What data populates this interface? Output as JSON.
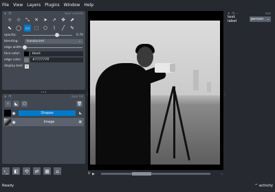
{
  "menu": [
    "File",
    "View",
    "Layers",
    "Plugins",
    "Window",
    "Help"
  ],
  "layer_controls": {
    "dock_title": "layer controls",
    "tools": [
      {
        "icon": "vertex-remove-icon",
        "glyph": "⊹"
      },
      {
        "icon": "vertex-insert-icon",
        "glyph": "⊹"
      },
      {
        "icon": "select-vertices-icon",
        "glyph": "⤡"
      },
      {
        "icon": "delete-shape-icon",
        "glyph": "✕"
      },
      {
        "icon": "select-shape-icon",
        "glyph": "➤"
      },
      {
        "icon": "direct-select-icon",
        "glyph": "➚"
      },
      {
        "icon": "pan-zoom-icon",
        "glyph": "✥"
      },
      {
        "icon": "move-front-icon",
        "glyph": "⬈"
      },
      {
        "icon": "move-back-icon",
        "glyph": "⬉"
      },
      {
        "icon": "ellipse-icon",
        "glyph": "◯"
      },
      {
        "icon": "rectangle-icon",
        "glyph": "▭"
      },
      {
        "icon": "add-rectangle-icon",
        "glyph": "⬚"
      },
      {
        "icon": "polygon-icon",
        "glyph": "⬠"
      },
      {
        "icon": "path-icon",
        "glyph": "⌇"
      },
      {
        "icon": "line-icon",
        "glyph": "╱"
      },
      {
        "icon": "freehand-icon",
        "glyph": "✎"
      }
    ],
    "active_tool_index": 10,
    "opacity_label": "opacity:",
    "opacity_value": "0.70",
    "opacity_fraction": 0.7,
    "blending_label": "blending:",
    "blending_value": "translucent",
    "edge_width_label": "edge width:",
    "edge_width_fraction": 0.0,
    "face_color_label": "face color:",
    "face_color_value": "black",
    "face_color_hex": "#000000",
    "edge_color_label": "edge color:",
    "edge_color_value": "#777777ff",
    "edge_color_hex": "#777777",
    "display_text_label": "display text:",
    "display_text_checked": "✓"
  },
  "layer_list": {
    "dock_title": "layer list",
    "layers": [
      {
        "name": "Shapes",
        "type_icon": "polygon-icon",
        "type_glyph": "◣",
        "selected": true
      },
      {
        "name": "Image",
        "type_icon": "image-icon",
        "type_glyph": "▣",
        "selected": false
      }
    ]
  },
  "bottom_tools": [
    {
      "icon": "console-icon",
      "glyph": "›_"
    },
    {
      "icon": "ndisplay-icon",
      "glyph": "◧"
    },
    {
      "icon": "roll-axes-icon",
      "glyph": "⟲"
    },
    {
      "icon": "transpose-icon",
      "glyph": "⇄"
    },
    {
      "icon": "grid-icon",
      "glyph": "▦"
    },
    {
      "icon": "home-icon",
      "glyph": "⌂"
    }
  ],
  "dims": {
    "index": "0",
    "play_glyph": "▶",
    "slider_fraction": 0.28
  },
  "right_panel": {
    "dock_title": "text",
    "text_label_label": "text label",
    "text_label_value": "person"
  },
  "status": {
    "text": "Ready",
    "activity": "^ activity"
  },
  "colors": {
    "accent": "#007acc",
    "panel": "#414851",
    "background": "#262930"
  }
}
